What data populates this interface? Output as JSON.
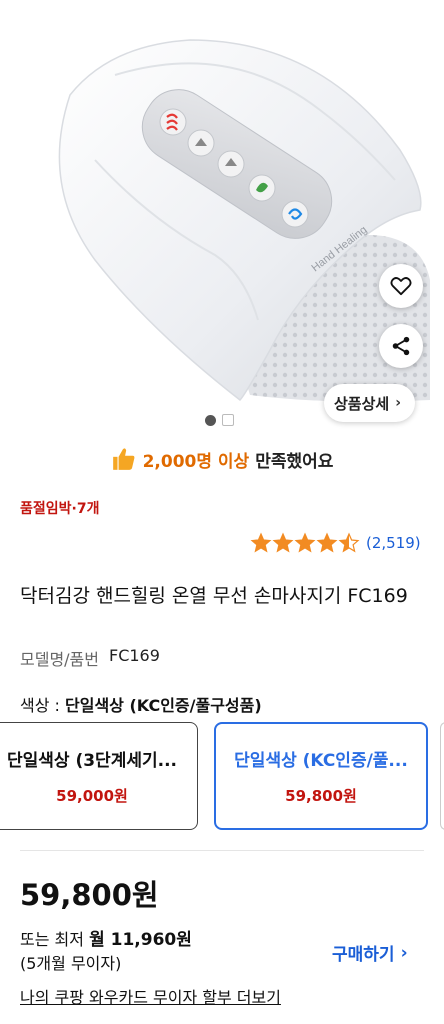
{
  "product_image": {
    "device_label": "Hand Healing",
    "accent_colors": {
      "heat": "#e53935",
      "green": "#43a047",
      "blue": "#1e88e5"
    }
  },
  "actions": {
    "detail_label": "상품상세",
    "detail_chevron": "›"
  },
  "satisfaction": {
    "highlight": "2,000명 이상",
    "rest": "만족했어요"
  },
  "stock_notice": "품절임박·7개",
  "rating": {
    "stars": 4.5,
    "count": "(2,519)"
  },
  "product": {
    "title": "닥터김강 핸드힐링 온열 무선 손마사지기 FC169",
    "model_key": "모델명/품번",
    "model_value": "FC169"
  },
  "options": {
    "label_prefix": "색상 : ",
    "selected": "단일색상 (KC인증/풀구성품)",
    "items": [
      {
        "name": "단일색상 (3단계세기...",
        "price": "59,000원"
      },
      {
        "name": "단일색상 (KC인증/풀...",
        "price": "59,800원"
      }
    ]
  },
  "pricing": {
    "final_price": "59,800원",
    "monthly_prefix": "또는 최저 ",
    "monthly_amount": "월 11,960원",
    "installment": "(5개월 무이자)",
    "buy_label": "구매하기",
    "buy_chevron": "›",
    "card_link": "나의 쿠팡 와우카드 무이자 할부 더보기"
  }
}
